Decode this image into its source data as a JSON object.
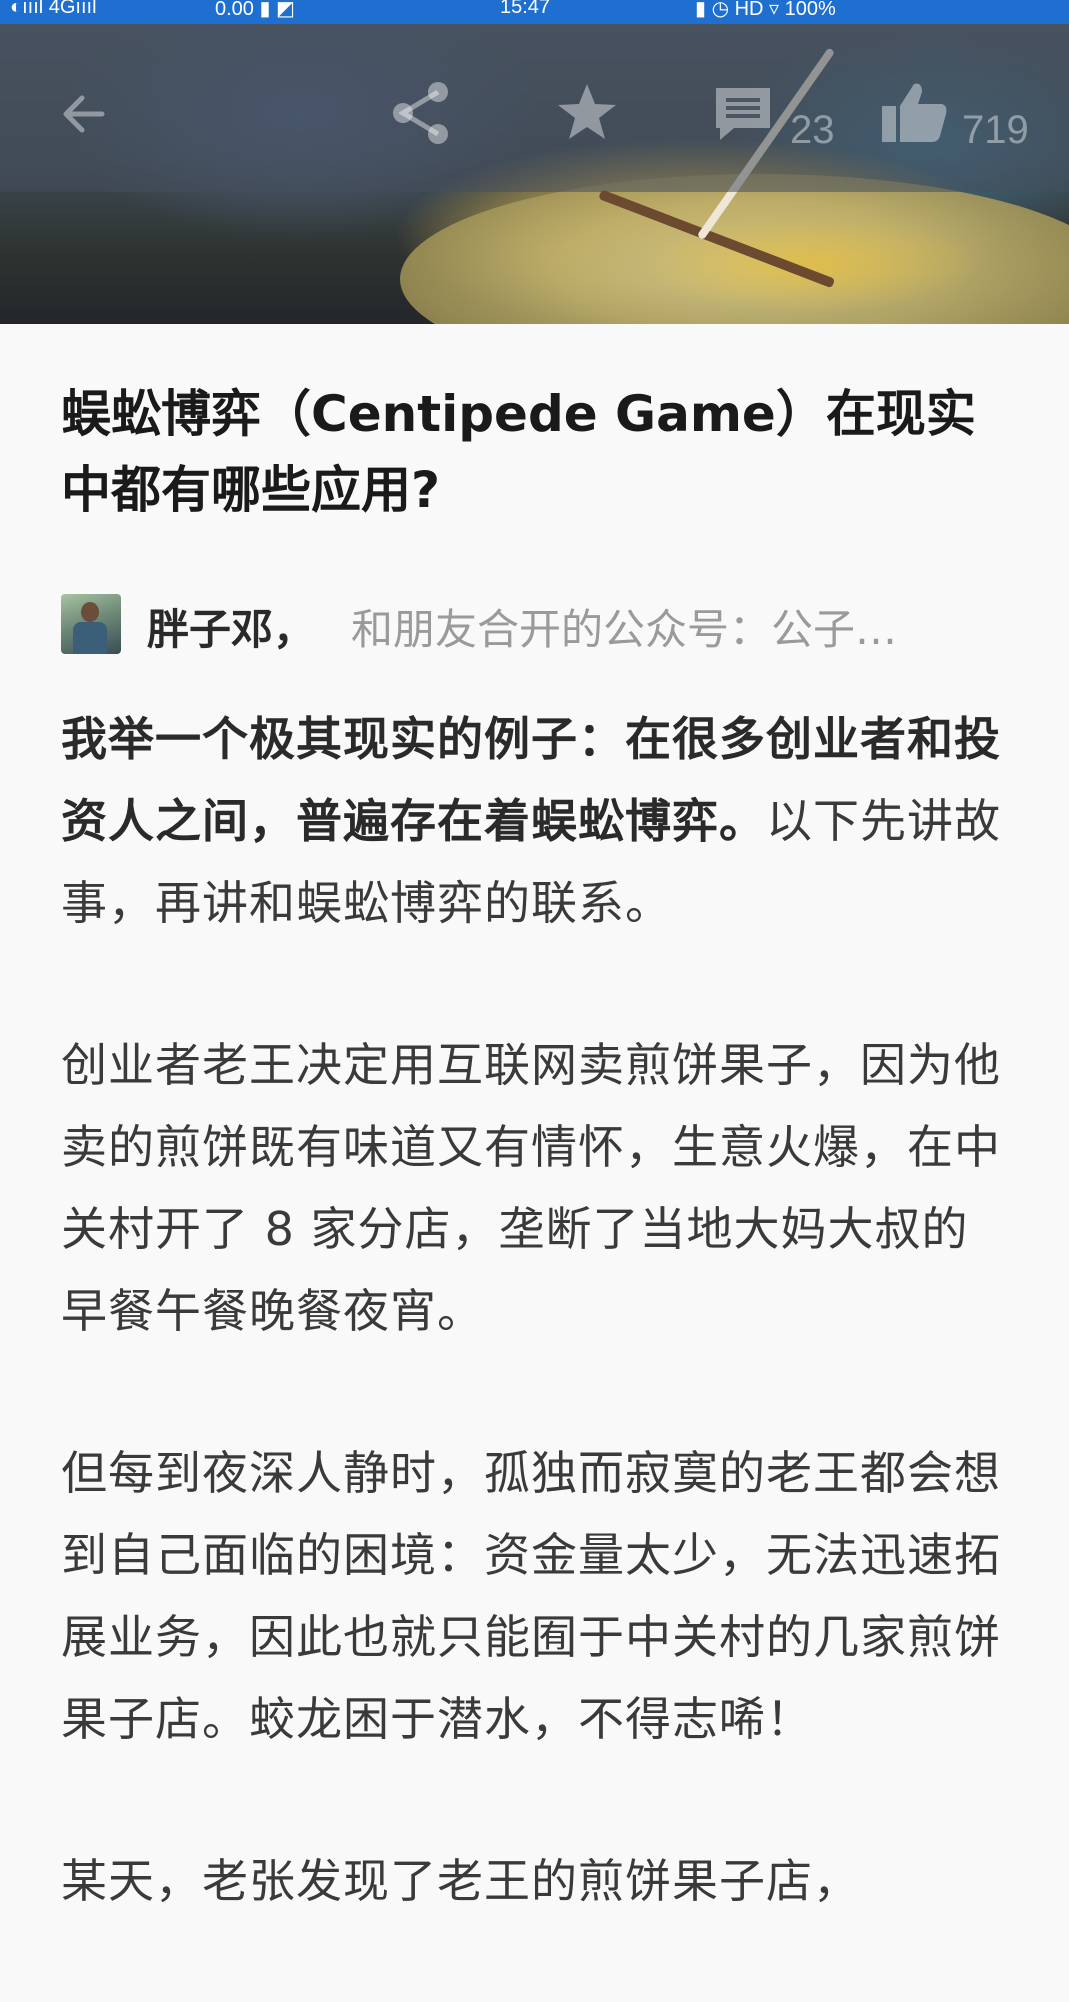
{
  "status_bar": {
    "left_text": "◐ıııl 4Gıııl",
    "middle_left_text": "0.00 ▮ ◩",
    "time": "15:47",
    "right_text": "▮ ◷ HD ▿ 100%"
  },
  "toolbar": {
    "back_icon": "back-arrow-icon",
    "share_icon": "share-icon",
    "star_icon": "star-icon",
    "comment_icon": "comment-icon",
    "comment_count": "23",
    "like_icon": "thumbs-up-icon",
    "like_count": "719"
  },
  "article": {
    "title": "蜈蚣博弈（Centipede Game）在现实中都有哪些应用?",
    "author_name": "胖子邓，",
    "author_bio": "和朋友合开的公众号：公子…",
    "paragraphs": [
      {
        "bold": "我举一个极其现实的例子：在很多创业者和投资人之间，普遍存在着蜈蚣博弈。",
        "text": "以下先讲故事，再讲和蜈蚣博弈的联系。"
      },
      {
        "bold": "",
        "text": "创业者老王决定用互联网卖煎饼果子，因为他卖的煎饼既有味道又有情怀，生意火爆，在中关村开了 8 家分店，垄断了当地大妈大叔的早餐午餐晚餐夜宵。"
      },
      {
        "bold": "",
        "text": "但每到夜深人静时，孤独而寂寞的老王都会想到自己面临的困境：资金量太少，无法迅速拓展业务，因此也就只能囿于中关村的几家煎饼果子店。蛟龙困于潜水，不得志唏！"
      },
      {
        "bold": "",
        "text": "某天，老张发现了老王的煎饼果子店，"
      }
    ]
  },
  "colors": {
    "status_bar_bg": "#1e6fd0",
    "page_bg": "#f9f9fa",
    "title_text": "#1a1a1a",
    "bio_text": "#9a9a9a"
  }
}
